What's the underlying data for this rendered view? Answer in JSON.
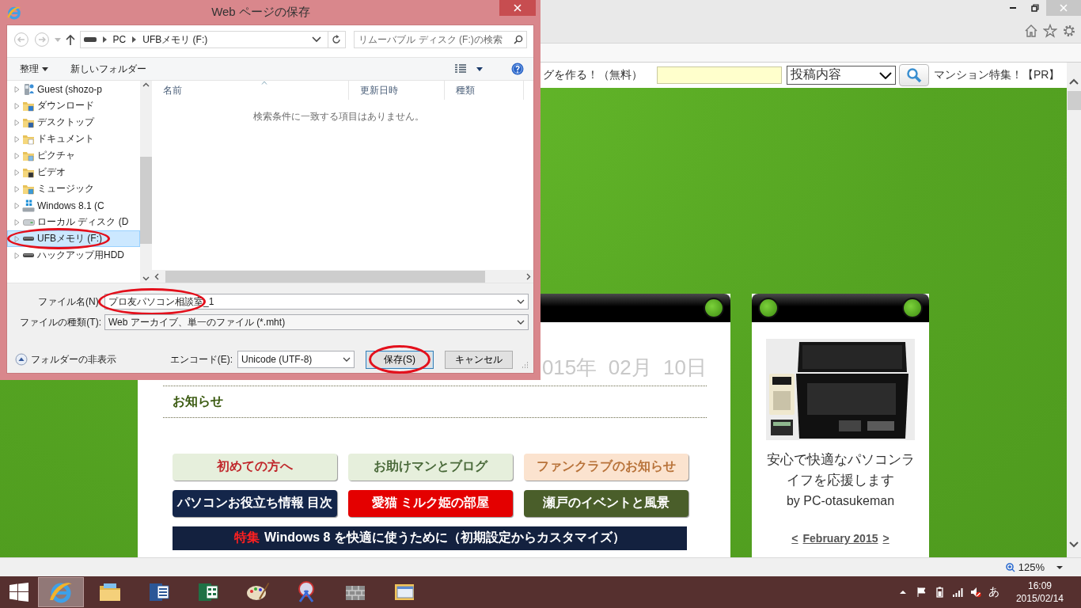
{
  "dialog": {
    "title": "Web ページの保存",
    "breadcrumb": [
      "PC",
      "UFBメモリ (F:)"
    ],
    "search": {
      "placeholder": "リムーバブル ディスク (F:)の検索"
    },
    "toolbar": {
      "organize": "整理",
      "new_folder": "新しいフォルダー"
    },
    "tree": [
      {
        "label": "Guest (shozo-p",
        "kind": "user",
        "selected": false,
        "circled": false
      },
      {
        "label": "ダウンロード",
        "kind": "download",
        "selected": false,
        "circled": false
      },
      {
        "label": "デスクトップ",
        "kind": "desktop",
        "selected": false,
        "circled": false
      },
      {
        "label": "ドキュメント",
        "kind": "documents",
        "selected": false,
        "circled": false
      },
      {
        "label": "ピクチャ",
        "kind": "pictures",
        "selected": false,
        "circled": false
      },
      {
        "label": "ビデオ",
        "kind": "videos",
        "selected": false,
        "circled": false
      },
      {
        "label": "ミュージック",
        "kind": "music",
        "selected": false,
        "circled": false
      },
      {
        "label": "Windows 8.1 (C",
        "kind": "windows-drive",
        "selected": false,
        "circled": false
      },
      {
        "label": "ローカル ディスク (D",
        "kind": "drive",
        "selected": false,
        "circled": false
      },
      {
        "label": "UFBメモリ (F:)",
        "kind": "usb-drive",
        "selected": true,
        "circled": true
      },
      {
        "label": "ハックアップ用HDD",
        "kind": "usb-drive",
        "selected": false,
        "circled": false
      }
    ],
    "columns": [
      "名前",
      "更新日時",
      "種類"
    ],
    "empty_message": "検索条件に一致する項目はありません。",
    "filename": {
      "label": "ファイル名(N):",
      "value": "プロ友パソコン相談室_1",
      "circled": true
    },
    "filetype": {
      "label": "ファイルの種類(T):",
      "value": "Web アーカイブ、単一のファイル (*.mht)"
    },
    "hide_folders": "フォルダーの非表示",
    "encoding": {
      "label": "エンコード(E):",
      "value": "Unicode (UTF-8)"
    },
    "buttons": [
      {
        "label": "保存(S)",
        "default": true,
        "circled": true
      },
      {
        "label": "キャンセル",
        "default": false,
        "circled": false
      }
    ]
  },
  "page": {
    "header_strip": {
      "promo": "グを作る！（無料）",
      "select": "投稿内容",
      "ad": "マンション特集！【PR】"
    },
    "main": {
      "date": "015年  02月  10日",
      "section": "お知らせ",
      "banners": [
        {
          "text": "初めての方へ",
          "color": "#e6efdc"
        },
        {
          "text": "お助けマンとブログ",
          "color": "#e6efdc"
        },
        {
          "text": "ファンクラブのお知らせ",
          "color": "#fbe3cf"
        },
        {
          "text": "パソコンお役立ち情報 目次",
          "color": "#14264a"
        },
        {
          "text": "愛猫 ミルク姫の部屋",
          "color": "#e40000"
        },
        {
          "text": "瀬戸のイベントと風景",
          "color": "#4a5e2a"
        }
      ],
      "feature": {
        "tag": "特集",
        "text": "Windows 8 を快適に使うために（初期設定からカスタマイズ）"
      }
    },
    "side": {
      "tagline": "安心で快適なパソコンライフを応援します",
      "author": "by PC-otasukeman",
      "calendar": {
        "prev": "<",
        "month": "February 2015",
        "next": ">"
      }
    }
  },
  "status_bar": {
    "zoom": "125%"
  },
  "taskbar": {
    "apps": [
      {
        "kind": "ie",
        "selected": true
      },
      {
        "kind": "explorer",
        "selected": false
      },
      {
        "kind": "word",
        "selected": false
      },
      {
        "kind": "excel",
        "selected": false
      },
      {
        "kind": "paint",
        "selected": false
      },
      {
        "kind": "snip",
        "selected": false
      },
      {
        "kind": "wall",
        "selected": false
      },
      {
        "kind": "window",
        "selected": false
      }
    ],
    "ime": "あ",
    "time": "16:09",
    "date": "2015/02/14"
  }
}
